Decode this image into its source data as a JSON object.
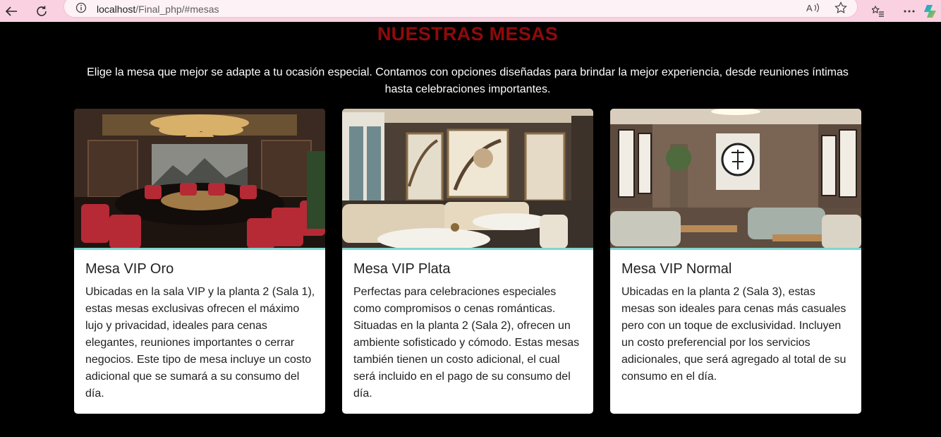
{
  "browser": {
    "url_host": "localhost",
    "url_path": "/Final_php/#mesas",
    "icons": [
      "back-arrow-icon",
      "reload-icon",
      "info-icon",
      "read-aloud-icon",
      "favorite-star-icon",
      "favorites-list-icon",
      "more-icon",
      "copilot-icon"
    ]
  },
  "section": {
    "title": "NUESTRAS MESAS",
    "intro": "Elige la mesa que mejor se adapte a tu ocasión especial. Contamos con opciones diseñadas para brindar la mejor experiencia, desde reuniones íntimas hasta celebraciones importantes."
  },
  "cards": [
    {
      "title": "Mesa VIP Oro",
      "text": "Ubicadas en la sala VIP y la planta 2 (Sala 1), estas mesas exclusivas ofrecen el máximo lujo y privacidad, ideales para cenas elegantes, reuniones importantes o cerrar negocios. Este tipo de mesa incluye un costo adicional que se sumará a su consumo del día."
    },
    {
      "title": "Mesa VIP Plata",
      "text": "Perfectas para celebraciones especiales como compromisos o cenas románticas. Situadas en la planta 2 (Sala 2), ofrecen un ambiente sofisticado y cómodo. Estas mesas también tienen un costo adicional, el cual será incluido en el pago de su consumo del día."
    },
    {
      "title": "Mesa VIP Normal",
      "text": "Ubicadas en la planta 2 (Sala 3), estas mesas son ideales para cenas más casuales pero con un toque de exclusividad. Incluyen un costo preferencial por los servicios adicionales, que será agregado al total de su consumo en el día."
    }
  ],
  "colors": {
    "title_red": "#8f0a0a",
    "accent_teal": "#7fd6d0",
    "browser_pink": "#f9d1e1"
  }
}
